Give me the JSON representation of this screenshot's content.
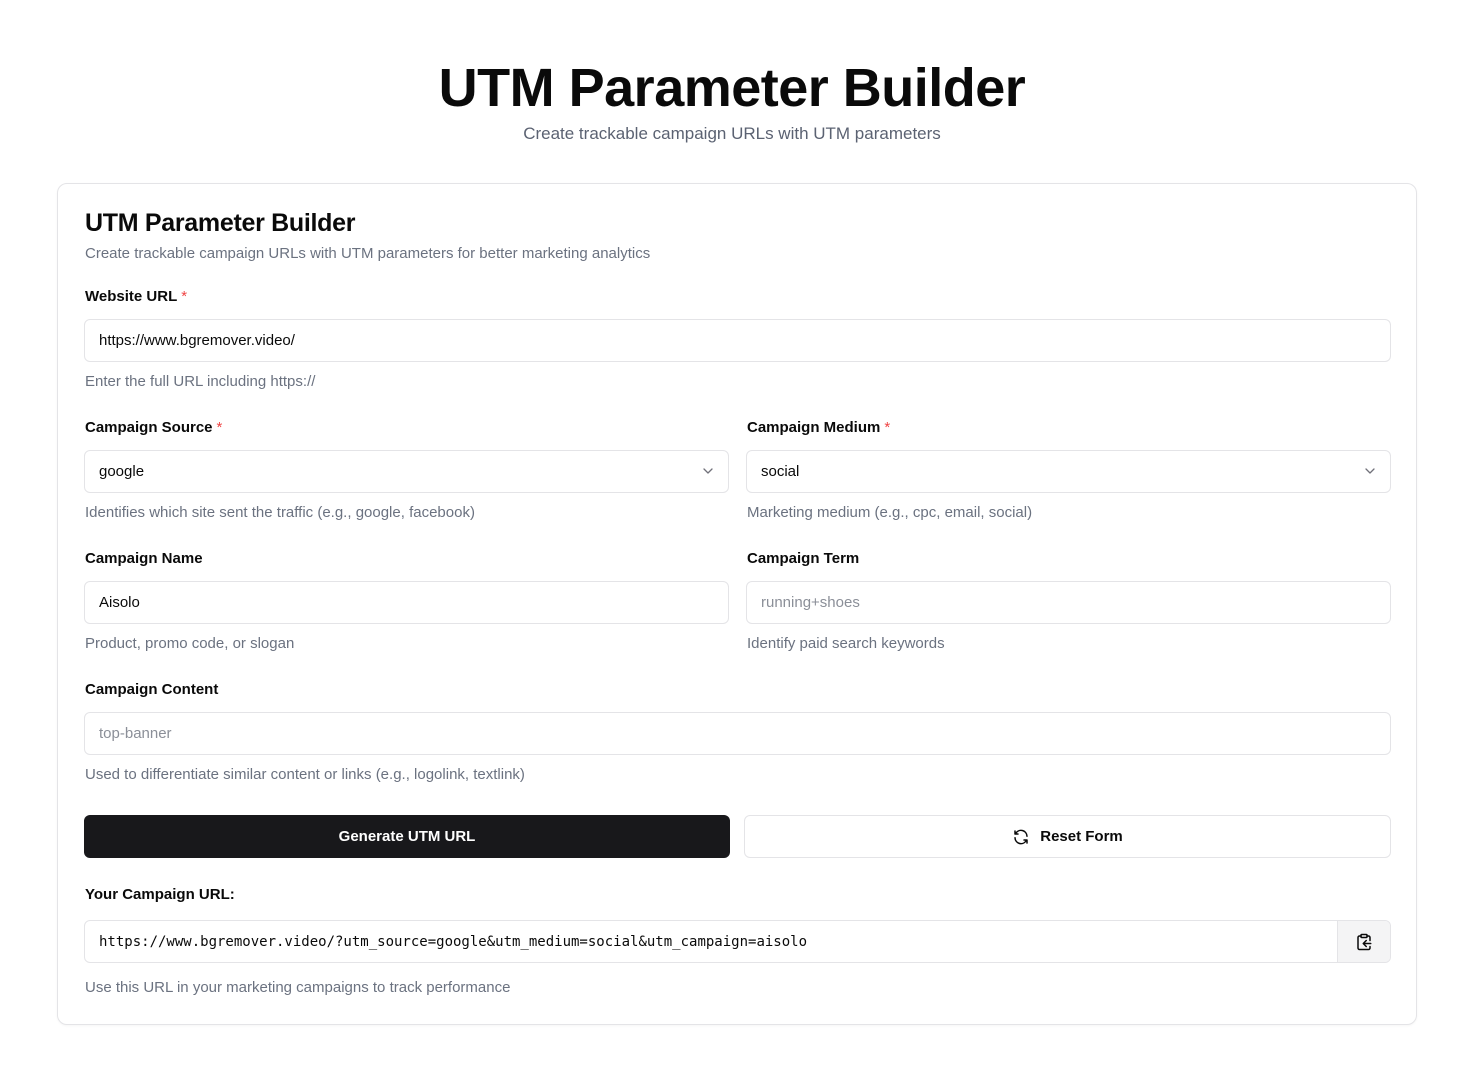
{
  "header": {
    "title": "UTM Parameter Builder",
    "subtitle": "Create trackable campaign URLs with UTM parameters"
  },
  "card": {
    "title": "UTM Parameter Builder",
    "description": "Create trackable campaign URLs with UTM parameters for better marketing analytics"
  },
  "required_marker": "*",
  "fields": {
    "website_url": {
      "label": "Website URL",
      "value": "https://www.bgremover.video/",
      "hint": "Enter the full URL including https://"
    },
    "campaign_source": {
      "label": "Campaign Source",
      "value": "google",
      "hint": "Identifies which site sent the traffic (e.g., google, facebook)"
    },
    "campaign_medium": {
      "label": "Campaign Medium",
      "value": "social",
      "hint": "Marketing medium (e.g., cpc, email, social)"
    },
    "campaign_name": {
      "label": "Campaign Name",
      "value": "Aisolo",
      "hint": "Product, promo code, or slogan"
    },
    "campaign_term": {
      "label": "Campaign Term",
      "value": "",
      "placeholder": "running+shoes",
      "hint": "Identify paid search keywords"
    },
    "campaign_content": {
      "label": "Campaign Content",
      "value": "",
      "placeholder": "top-banner",
      "hint": "Used to differentiate similar content or links (e.g., logolink, textlink)"
    }
  },
  "actions": {
    "generate_label": "Generate UTM URL",
    "reset_label": "Reset Form",
    "reset_icon": "refresh-icon"
  },
  "result": {
    "label": "Your Campaign URL:",
    "url": "https://www.bgremover.video/?utm_source=google&utm_medium=social&utm_campaign=aisolo",
    "copy_icon": "clipboard-copy-icon",
    "hint": "Use this URL in your marketing campaigns to track performance"
  },
  "colors": {
    "primary_button": "#18181b",
    "required": "#ef4444",
    "muted_text": "#6b7280",
    "border": "#e4e4e7"
  }
}
